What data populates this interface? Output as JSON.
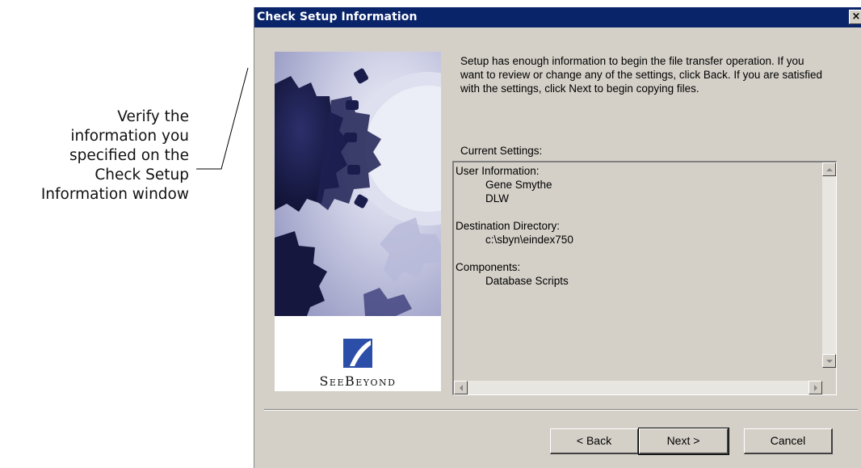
{
  "callout": {
    "lines": [
      "Verify the",
      "information you",
      "specified on the",
      "Check Setup",
      "Information window"
    ]
  },
  "dialog": {
    "title": "Check Setup Information",
    "close_label": "×",
    "description": "Setup has enough information to begin the file transfer operation.  If you want to review or change any of the settings, click Back.  If you are satisfied with the settings, click Next to begin copying files.",
    "settings_label": "Current Settings:",
    "settings": {
      "user_heading": "User Information:",
      "user_name": "Gene Smythe",
      "user_company": "DLW",
      "dest_heading": "Destination Directory:",
      "dest_path": "c:\\sbyn\\eindex750",
      "comp_heading": "Components:",
      "comp_item": "Database Scripts"
    },
    "logo_text": "SeeBeyond",
    "buttons": {
      "back": "< Back",
      "next": "Next >",
      "cancel": "Cancel"
    }
  },
  "colors": {
    "titlebar": "#0a246a",
    "dialog_face": "#d4d0c8"
  }
}
